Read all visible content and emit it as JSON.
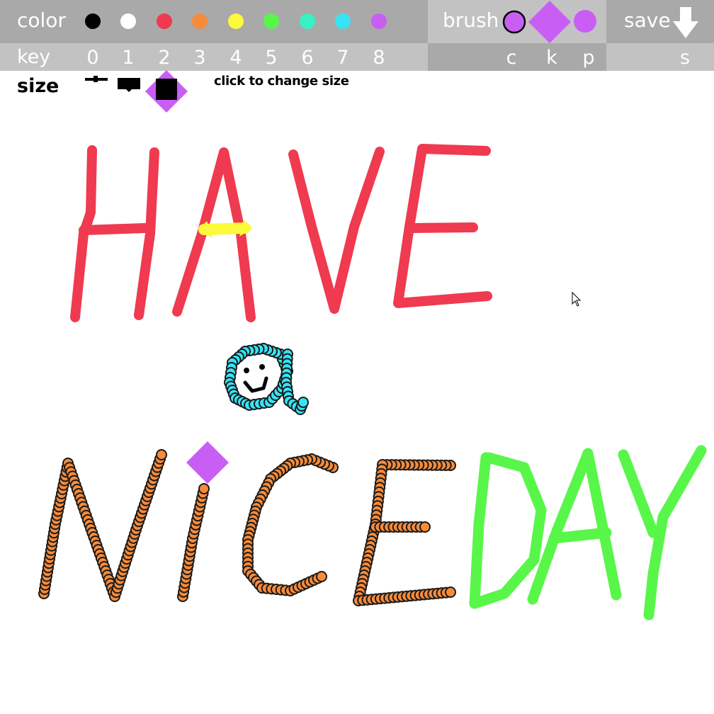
{
  "toolbar": {
    "color_label": "color",
    "key_label": "key",
    "brush_label": "brush",
    "save_label": "save",
    "colors": [
      {
        "key": "0",
        "hex": "#000000"
      },
      {
        "key": "1",
        "hex": "#ffffff"
      },
      {
        "key": "2",
        "hex": "#ef3a4f"
      },
      {
        "key": "3",
        "hex": "#f68b3a"
      },
      {
        "key": "4",
        "hex": "#fafa3b"
      },
      {
        "key": "5",
        "hex": "#59f64a"
      },
      {
        "key": "6",
        "hex": "#37f1c4"
      },
      {
        "key": "7",
        "hex": "#36e4f6"
      },
      {
        "key": "8",
        "hex": "#c95ef5"
      }
    ],
    "brushes": [
      {
        "key": "c",
        "name": "circle-outline"
      },
      {
        "key": "k",
        "name": "diamond"
      },
      {
        "key": "p",
        "name": "circle"
      }
    ],
    "save_key": "s"
  },
  "size": {
    "label": "size",
    "hint": "click to change size",
    "options": [
      "small",
      "medium",
      "large"
    ],
    "selected": "large"
  },
  "canvas": {
    "text_drawn": [
      "HAVE",
      "a",
      "NICE",
      "DAY"
    ]
  },
  "theme": {
    "toolbar_dark": "#a8a8a8",
    "toolbar_light": "#c2c2c2",
    "brush_accent": "#c95ef5"
  }
}
